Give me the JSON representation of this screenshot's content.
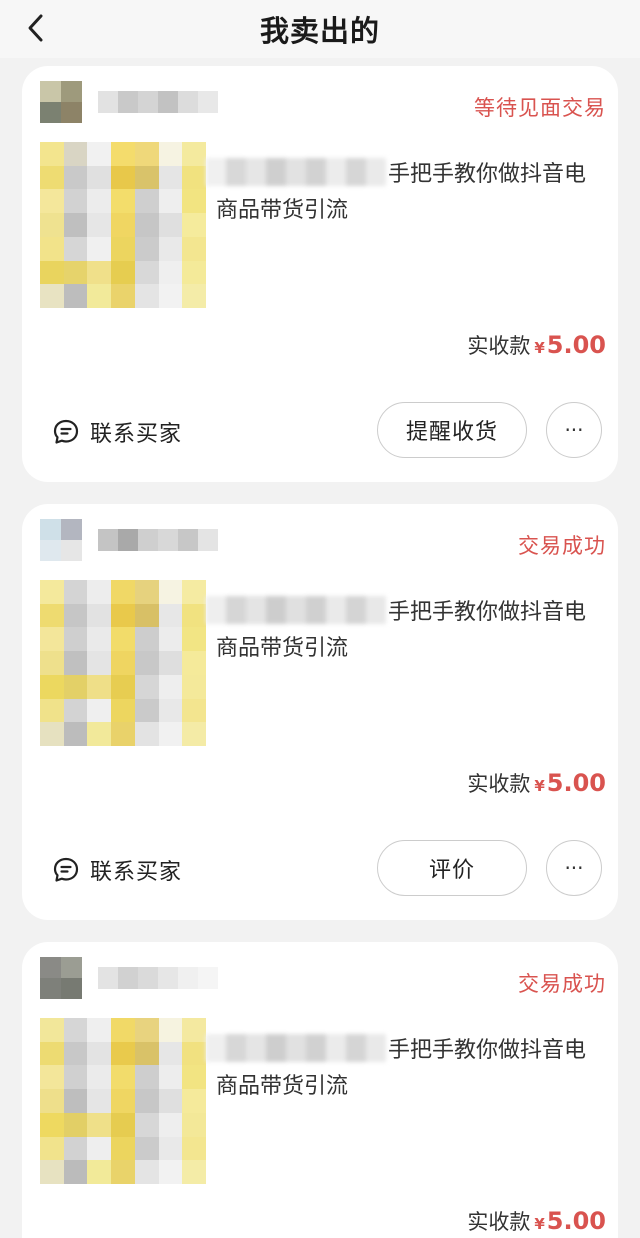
{
  "header": {
    "title": "我卖出的"
  },
  "orders": [
    {
      "status": "等待见面交易",
      "product_title_line1": "手把手教你做抖音电",
      "product_title_line2": "商品带货引流",
      "price_label": "实收款",
      "price_currency": "¥",
      "price_value": "5.00",
      "contact_label": "联系买家",
      "action_label": "提醒收货",
      "more_label": "···"
    },
    {
      "status": "交易成功",
      "product_title_line1": "手把手教你做抖音电",
      "product_title_line2": "商品带货引流",
      "price_label": "实收款",
      "price_currency": "¥",
      "price_value": "5.00",
      "contact_label": "联系买家",
      "action_label": "评价",
      "more_label": "···"
    },
    {
      "status": "交易成功",
      "product_title_line1": "手把手教你做抖音电",
      "product_title_line2": "商品带货引流",
      "price_label": "实收款",
      "price_currency": "¥",
      "price_value": "5.00"
    }
  ],
  "icons": {
    "back": "chevron-left-icon",
    "contact": "chat-bubble-icon"
  },
  "colors": {
    "accent": "#d9534f",
    "background": "#f2f2f2",
    "card": "#ffffff"
  }
}
